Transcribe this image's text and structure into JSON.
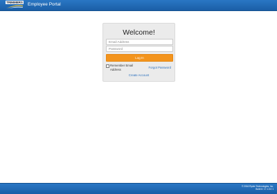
{
  "header": {
    "logo_text": "TRIMMERS",
    "title": "Employee Portal"
  },
  "login": {
    "heading": "Welcome!",
    "email_placeholder": "Email Address",
    "password_placeholder": "Password",
    "login_label": "Log In",
    "remember_label": "Remember Email Address",
    "forgot_label": "Forgot Password",
    "create_label": "Create Account"
  },
  "footer": {
    "copyright": "© 2016 Ryder Technologies, Inc.",
    "build": "Build #: 17.1.0.0 1"
  },
  "colors": {
    "header_bar": "#1f66b0",
    "login_button": "#f3941d",
    "link": "#2a6fbd",
    "card": "#ebebeb"
  }
}
